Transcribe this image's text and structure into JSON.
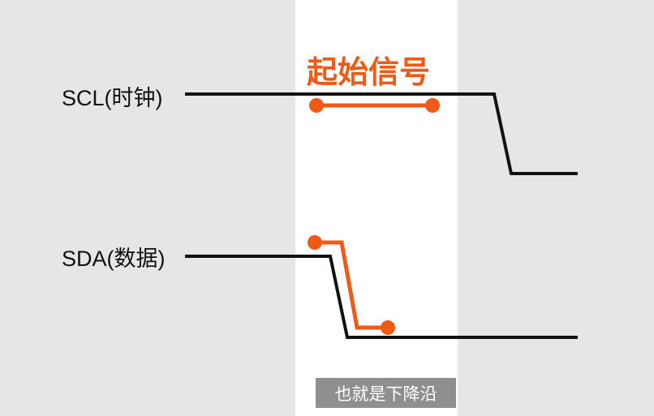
{
  "diagram": {
    "title": "起始信号",
    "signals": {
      "scl_label": "SCL(时钟)",
      "sda_label": "SDA(数据)"
    },
    "caption": "也就是下降沿",
    "colors": {
      "background": "#e6e6e6",
      "highlight": "#ffffff",
      "signal_line": "#111111",
      "accent": "#f05a16",
      "caption_bg": "#8f8f8f"
    }
  }
}
